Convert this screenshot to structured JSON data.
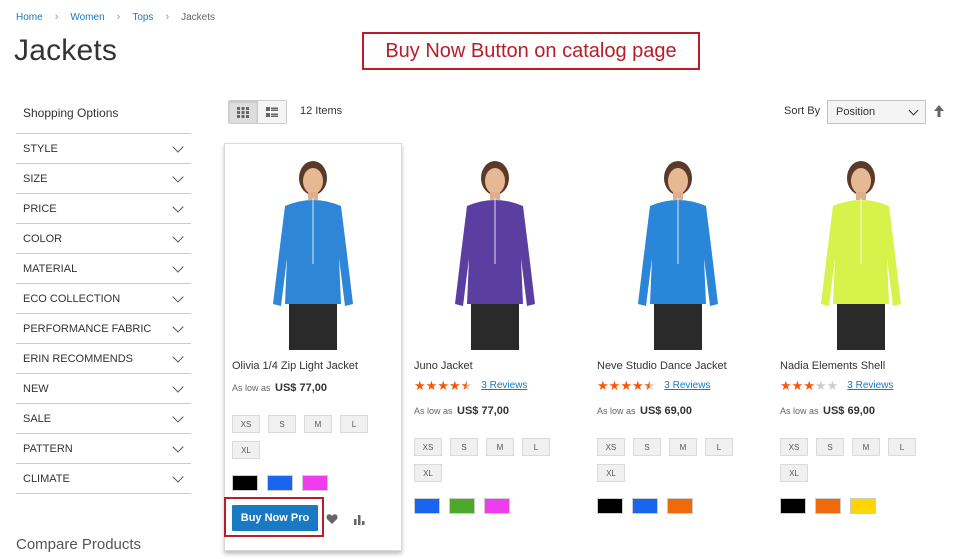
{
  "breadcrumb": [
    {
      "label": "Home"
    },
    {
      "label": "Women"
    },
    {
      "label": "Tops"
    },
    {
      "label": "Jackets"
    }
  ],
  "page_title": "Jackets",
  "annotation": "Buy Now Button on catalog page",
  "sidebar": {
    "title": "Shopping Options",
    "filters": [
      "STYLE",
      "SIZE",
      "PRICE",
      "COLOR",
      "MATERIAL",
      "ECO COLLECTION",
      "PERFORMANCE FABRIC",
      "ERIN RECOMMENDS",
      "NEW",
      "SALE",
      "PATTERN",
      "CLIMATE"
    ],
    "compare_title": "Compare Products"
  },
  "toolbar": {
    "amount": "12 Items",
    "sort_label": "Sort By",
    "sort_value": "Position",
    "view_modes": [
      "grid-icon",
      "list-icon"
    ]
  },
  "products": [
    {
      "name": "Olivia 1/4 Zip Light Jacket",
      "price_prefix": "As low as",
      "price": "US$ 77,00",
      "sizes": [
        "XS",
        "S",
        "M",
        "L",
        "XL"
      ],
      "colors": [
        "#000000",
        "#1965ee",
        "#ee3cee"
      ],
      "jacket_color": "#2f86d6",
      "buy_now_label": "Buy Now Pro",
      "has_rating": false
    },
    {
      "name": "Juno Jacket",
      "rating": 4.5,
      "reviews": "3  Reviews",
      "price_prefix": "As low as",
      "price": "US$ 77,00",
      "sizes": [
        "XS",
        "S",
        "M",
        "L",
        "XL"
      ],
      "colors": [
        "#1965ee",
        "#4caa2a",
        "#ee3cee"
      ],
      "jacket_color": "#5b3fa0",
      "has_rating": true
    },
    {
      "name": "Neve Studio Dance Jacket",
      "rating": 4.5,
      "reviews": "3  Reviews",
      "price_prefix": "As low as",
      "price": "US$ 69,00",
      "sizes": [
        "XS",
        "S",
        "M",
        "L",
        "XL"
      ],
      "colors": [
        "#000000",
        "#1965ee",
        "#ee6a0a"
      ],
      "jacket_color": "#2a86d8",
      "has_rating": true
    },
    {
      "name": "Nadia Elements Shell",
      "rating": 3,
      "reviews": "3  Reviews",
      "price_prefix": "As low as",
      "price": "US$ 69,00",
      "sizes": [
        "XS",
        "S",
        "M",
        "L",
        "XL"
      ],
      "colors": [
        "#000000",
        "#ee6a0a",
        "#ffd500"
      ],
      "jacket_color": "#d7f24a",
      "has_rating": true
    }
  ],
  "colors": {
    "link": "#1979c3",
    "accent_red": "#b81d2a",
    "star": "#ff5501"
  }
}
